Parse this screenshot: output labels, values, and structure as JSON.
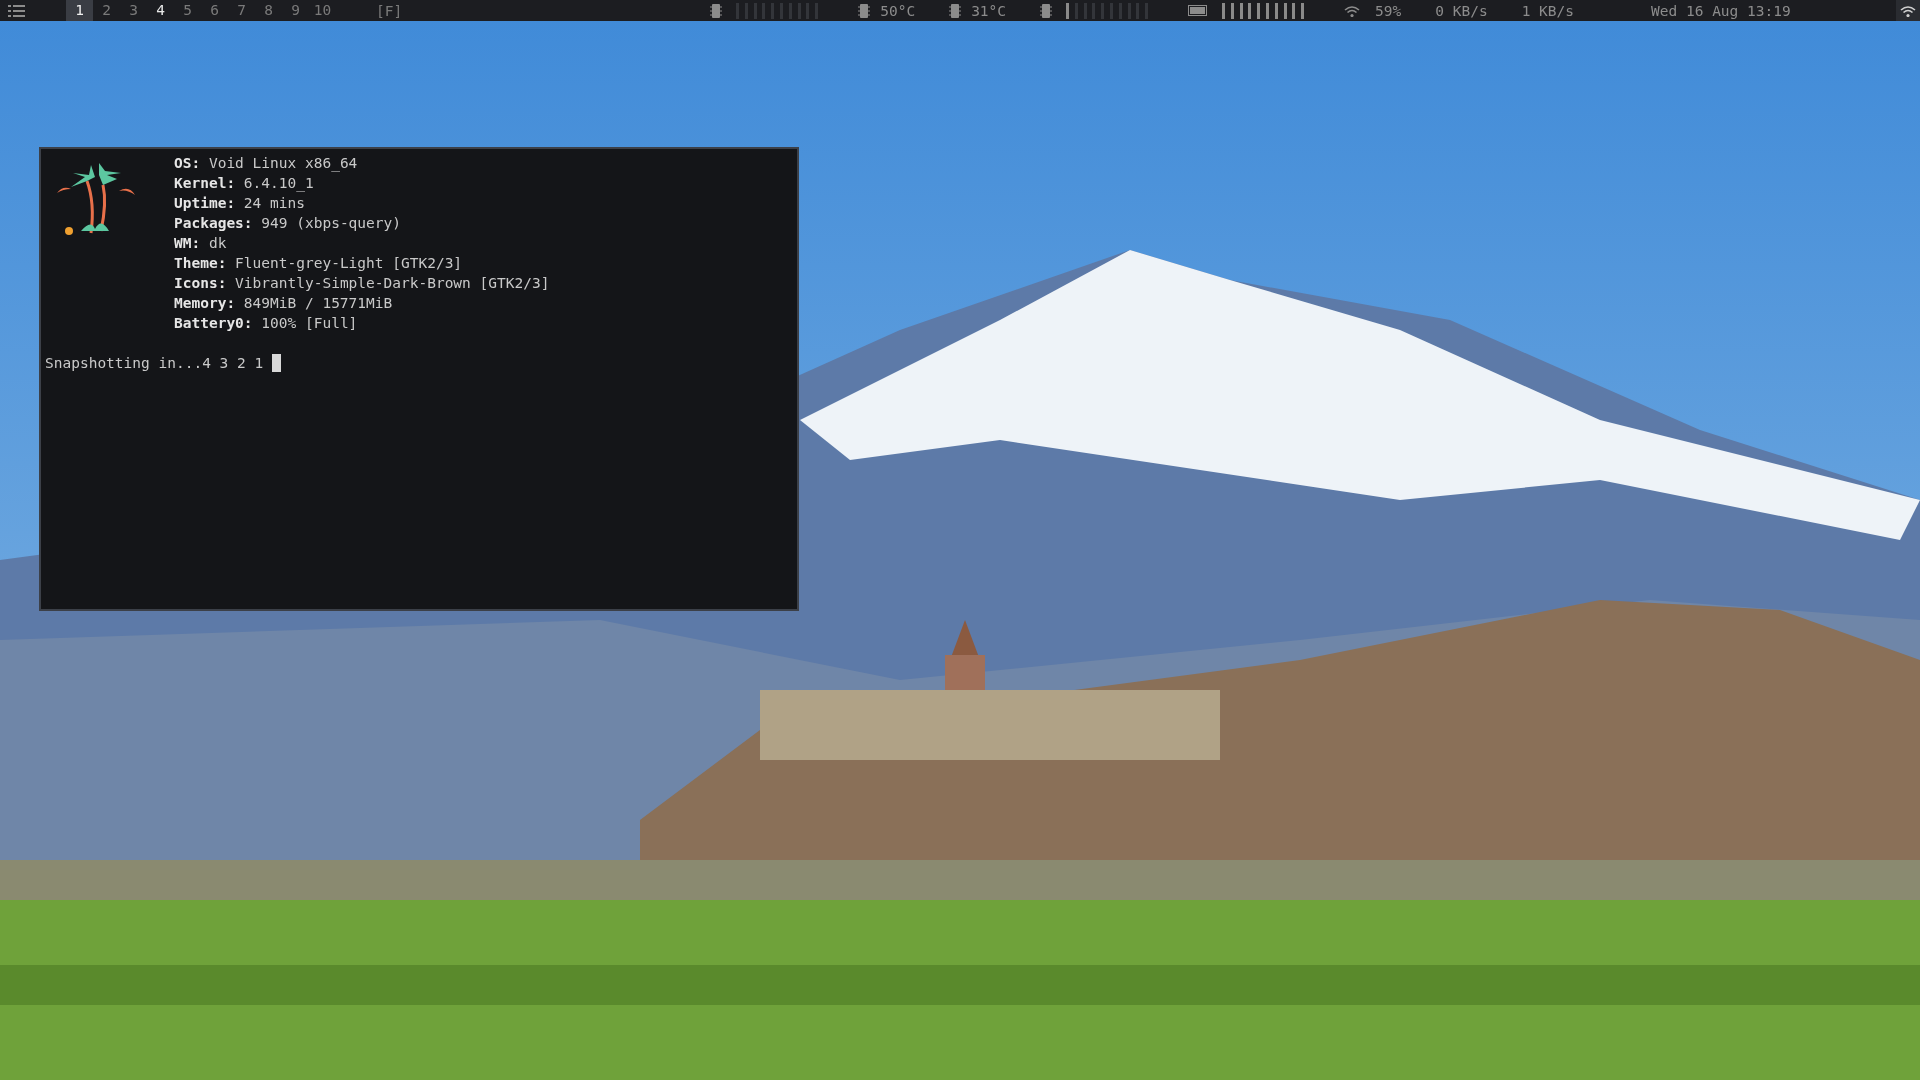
{
  "top_bar": {
    "workspaces": [
      {
        "label": "1",
        "selected": true,
        "occupied": true
      },
      {
        "label": "2",
        "selected": false,
        "occupied": false
      },
      {
        "label": "3",
        "selected": false,
        "occupied": false
      },
      {
        "label": "4",
        "selected": false,
        "occupied": true
      },
      {
        "label": "5",
        "selected": false,
        "occupied": false
      },
      {
        "label": "6",
        "selected": false,
        "occupied": false
      },
      {
        "label": "7",
        "selected": false,
        "occupied": false
      },
      {
        "label": "8",
        "selected": false,
        "occupied": false
      },
      {
        "label": "9",
        "selected": false,
        "occupied": false
      },
      {
        "label": "10",
        "selected": false,
        "occupied": false
      }
    ],
    "layout": "[F]",
    "cpu_meter": {
      "level": 0
    },
    "temperatures": [
      "50°C",
      "31°C"
    ],
    "memory_meter": {
      "level": 0.1
    },
    "battery_meter": {
      "level": 1
    },
    "wifi_strength": "59%",
    "download_rate": "0 KB/s",
    "upload_rate": "1 KB/s",
    "clock": "Wed 16 Aug 13:19"
  },
  "terminal": {
    "info_lines": [
      "**OS:** Void Linux x86_64",
      "**Kernel:** 6.4.10_1",
      "**Uptime:** 24 mins",
      "**Packages:** 949 (xbps-query)",
      "**WM:** dk",
      "**Theme:** Fluent-grey-Light [GTK2/3]",
      "**Icons:** Vibrantly-Simple-Dark-Brown [GTK2/3]",
      "**Memory:** 849MiB / 15771MiB",
      "**Battery0:** 100% [Full]"
    ],
    "prompt": "Snapshotting in...4 3 2 1"
  }
}
